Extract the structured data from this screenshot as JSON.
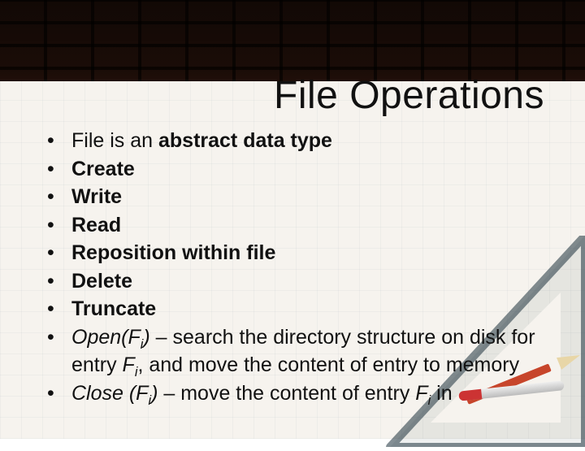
{
  "title": "File Operations",
  "bullets": {
    "b1_prefix": "File is an ",
    "b1_bold": "abstract data type",
    "b2": "Create",
    "b3": "Write",
    "b4": "Read",
    "b5": "Reposition within file",
    "b6": "Delete",
    "b7": "Truncate",
    "b8_open": "Open(F",
    "b8_sub1": "i",
    "b8_close": ")",
    "b8_text1": " – search the directory structure on disk for entry ",
    "b8_fi": "F",
    "b8_sub2": "i",
    "b8_text2": ", and move the content of entry to memory",
    "b9_open": "Close (F",
    "b9_sub1": "i",
    "b9_close": ")",
    "b9_text1": " – move the content of entry ",
    "b9_fi": "F",
    "b9_sub2": "i",
    "b9_text2": " in"
  }
}
